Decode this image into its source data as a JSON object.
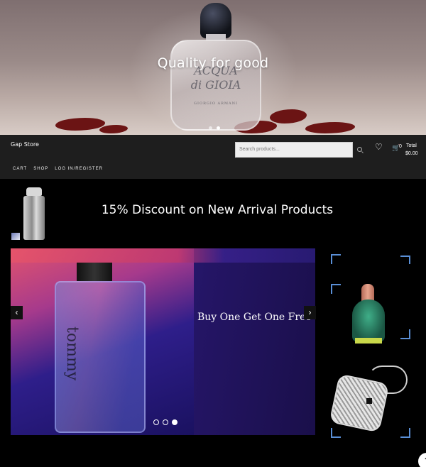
{
  "hero": {
    "title": "Quality for good",
    "bottle_label_line1": "ACQUA",
    "bottle_label_line2": "di GIOIA",
    "bottle_brand": "GIORGIO ARMANI",
    "dots": 2,
    "active_dot": 2
  },
  "header": {
    "brand": "Gap Store",
    "search_placeholder": "Search products...",
    "cart_count": "0",
    "total_label": "Total",
    "total_amount": "$0.00",
    "nav": [
      "CART",
      "SHOP",
      "LOG IN/REGISTER"
    ]
  },
  "promo": {
    "discount_text": "15% Discount on New Arrival Products"
  },
  "slider": {
    "caption": "Buy One Get One Free",
    "bottle_brand": "tommy",
    "active_slide": 3,
    "slide_count": 3
  },
  "colors": {
    "header_bg": "#1e1e1e",
    "page_bg": "#000000",
    "corner_accent": "#5a8fd6"
  },
  "icons": {
    "heart": "heart-icon",
    "cart": "basket-icon",
    "search": "search-icon",
    "prev": "chevron-left-icon",
    "next": "chevron-right-icon",
    "scroll_top": "chevron-up-icon"
  }
}
